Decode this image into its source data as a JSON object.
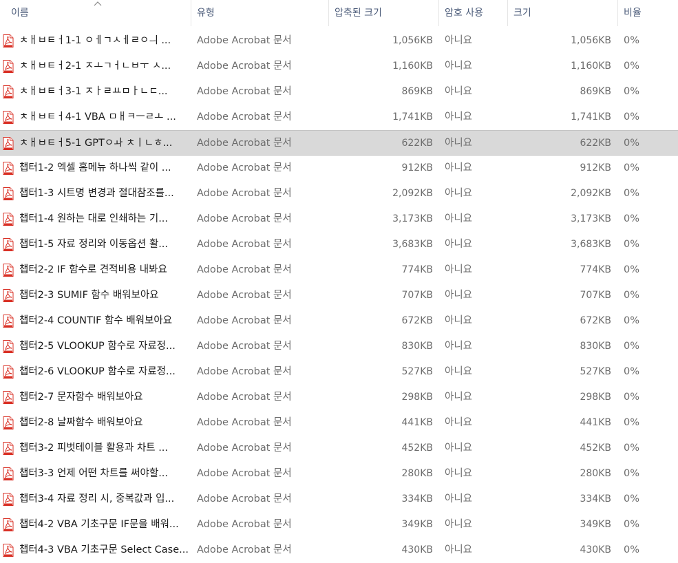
{
  "header": {
    "name": "이름",
    "type": "유형",
    "compressed": "압축된 크기",
    "password": "암호 사용",
    "size": "크기",
    "ratio": "비율"
  },
  "icon": "pdf-file-icon",
  "colors": {
    "selected_row": "#d9d9d9",
    "header_text": "#4a5a78",
    "pdf_red": "#d93025"
  },
  "rows": [
    {
      "name": "ㅊㅐㅂㅌㅓ1-1 ㅇㅔㄱㅅㅔㄹㅇㅢ ...",
      "type": "Adobe Acrobat 문서",
      "compressed": "1,056KB",
      "password": "아니요",
      "size": "1,056KB",
      "ratio": "0%"
    },
    {
      "name": "ㅊㅐㅂㅌㅓ2-1 ㅈㅗㄱㅓㄴㅂㅜ ㅅ...",
      "type": "Adobe Acrobat 문서",
      "compressed": "1,160KB",
      "password": "아니요",
      "size": "1,160KB",
      "ratio": "0%"
    },
    {
      "name": "ㅊㅐㅂㅌㅓ3-1 ㅈㅏㄹㅛㅁㅏㄴㄷ...",
      "type": "Adobe Acrobat 문서",
      "compressed": "869KB",
      "password": "아니요",
      "size": "869KB",
      "ratio": "0%"
    },
    {
      "name": "ㅊㅐㅂㅌㅓ4-1 VBA ㅁㅐㅋㅡㄹㅗ ...",
      "type": "Adobe Acrobat 문서",
      "compressed": "1,741KB",
      "password": "아니요",
      "size": "1,741KB",
      "ratio": "0%"
    },
    {
      "name": "ㅊㅐㅂㅌㅓ5-1 GPTㅇㅘ ㅊㅣㄴㅎ...",
      "type": "Adobe Acrobat 문서",
      "compressed": "622KB",
      "password": "아니요",
      "size": "622KB",
      "ratio": "0%",
      "selected": true
    },
    {
      "name": "챕터1-2 엑셀 홈메뉴 하나씩 같이 ...",
      "type": "Adobe Acrobat 문서",
      "compressed": "912KB",
      "password": "아니요",
      "size": "912KB",
      "ratio": "0%"
    },
    {
      "name": "챕터1-3 시트명 변경과 절대참조를...",
      "type": "Adobe Acrobat 문서",
      "compressed": "2,092KB",
      "password": "아니요",
      "size": "2,092KB",
      "ratio": "0%"
    },
    {
      "name": "챕터1-4 원하는 대로 인쇄하는 기...",
      "type": "Adobe Acrobat 문서",
      "compressed": "3,173KB",
      "password": "아니요",
      "size": "3,173KB",
      "ratio": "0%"
    },
    {
      "name": "챕터1-5 자료 정리와 이동옵션 활...",
      "type": "Adobe Acrobat 문서",
      "compressed": "3,683KB",
      "password": "아니요",
      "size": "3,683KB",
      "ratio": "0%"
    },
    {
      "name": "챕터2-2 IF 함수로 견적비용 내봐요",
      "type": "Adobe Acrobat 문서",
      "compressed": "774KB",
      "password": "아니요",
      "size": "774KB",
      "ratio": "0%"
    },
    {
      "name": "챕터2-3 SUMIF 함수 배워보아요",
      "type": "Adobe Acrobat 문서",
      "compressed": "707KB",
      "password": "아니요",
      "size": "707KB",
      "ratio": "0%"
    },
    {
      "name": "챕터2-4 COUNTIF 함수 배워보아요",
      "type": "Adobe Acrobat 문서",
      "compressed": "672KB",
      "password": "아니요",
      "size": "672KB",
      "ratio": "0%"
    },
    {
      "name": "챕터2-5 VLOOKUP 함수로 자료정...",
      "type": "Adobe Acrobat 문서",
      "compressed": "830KB",
      "password": "아니요",
      "size": "830KB",
      "ratio": "0%"
    },
    {
      "name": "챕터2-6 VLOOKUP 함수로 자료정...",
      "type": "Adobe Acrobat 문서",
      "compressed": "527KB",
      "password": "아니요",
      "size": "527KB",
      "ratio": "0%"
    },
    {
      "name": "챕터2-7 문자함수 배워보아요",
      "type": "Adobe Acrobat 문서",
      "compressed": "298KB",
      "password": "아니요",
      "size": "298KB",
      "ratio": "0%"
    },
    {
      "name": "챕터2-8 날짜함수 배워보아요",
      "type": "Adobe Acrobat 문서",
      "compressed": "441KB",
      "password": "아니요",
      "size": "441KB",
      "ratio": "0%"
    },
    {
      "name": "챕터3-2 피벗테이블 활용과 차트 ...",
      "type": "Adobe Acrobat 문서",
      "compressed": "452KB",
      "password": "아니요",
      "size": "452KB",
      "ratio": "0%"
    },
    {
      "name": "챕터3-3 언제 어떤 차트를 써야할...",
      "type": "Adobe Acrobat 문서",
      "compressed": "280KB",
      "password": "아니요",
      "size": "280KB",
      "ratio": "0%"
    },
    {
      "name": "챕터3-4 자료 정리 시, 중복값과 입...",
      "type": "Adobe Acrobat 문서",
      "compressed": "334KB",
      "password": "아니요",
      "size": "334KB",
      "ratio": "0%"
    },
    {
      "name": "챕터4-2 VBA 기초구문 IF문을 배워...",
      "type": "Adobe Acrobat 문서",
      "compressed": "349KB",
      "password": "아니요",
      "size": "349KB",
      "ratio": "0%"
    },
    {
      "name": "챕터4-3 VBA 기초구문 Select Case...",
      "type": "Adobe Acrobat 문서",
      "compressed": "430KB",
      "password": "아니요",
      "size": "430KB",
      "ratio": "0%"
    }
  ]
}
